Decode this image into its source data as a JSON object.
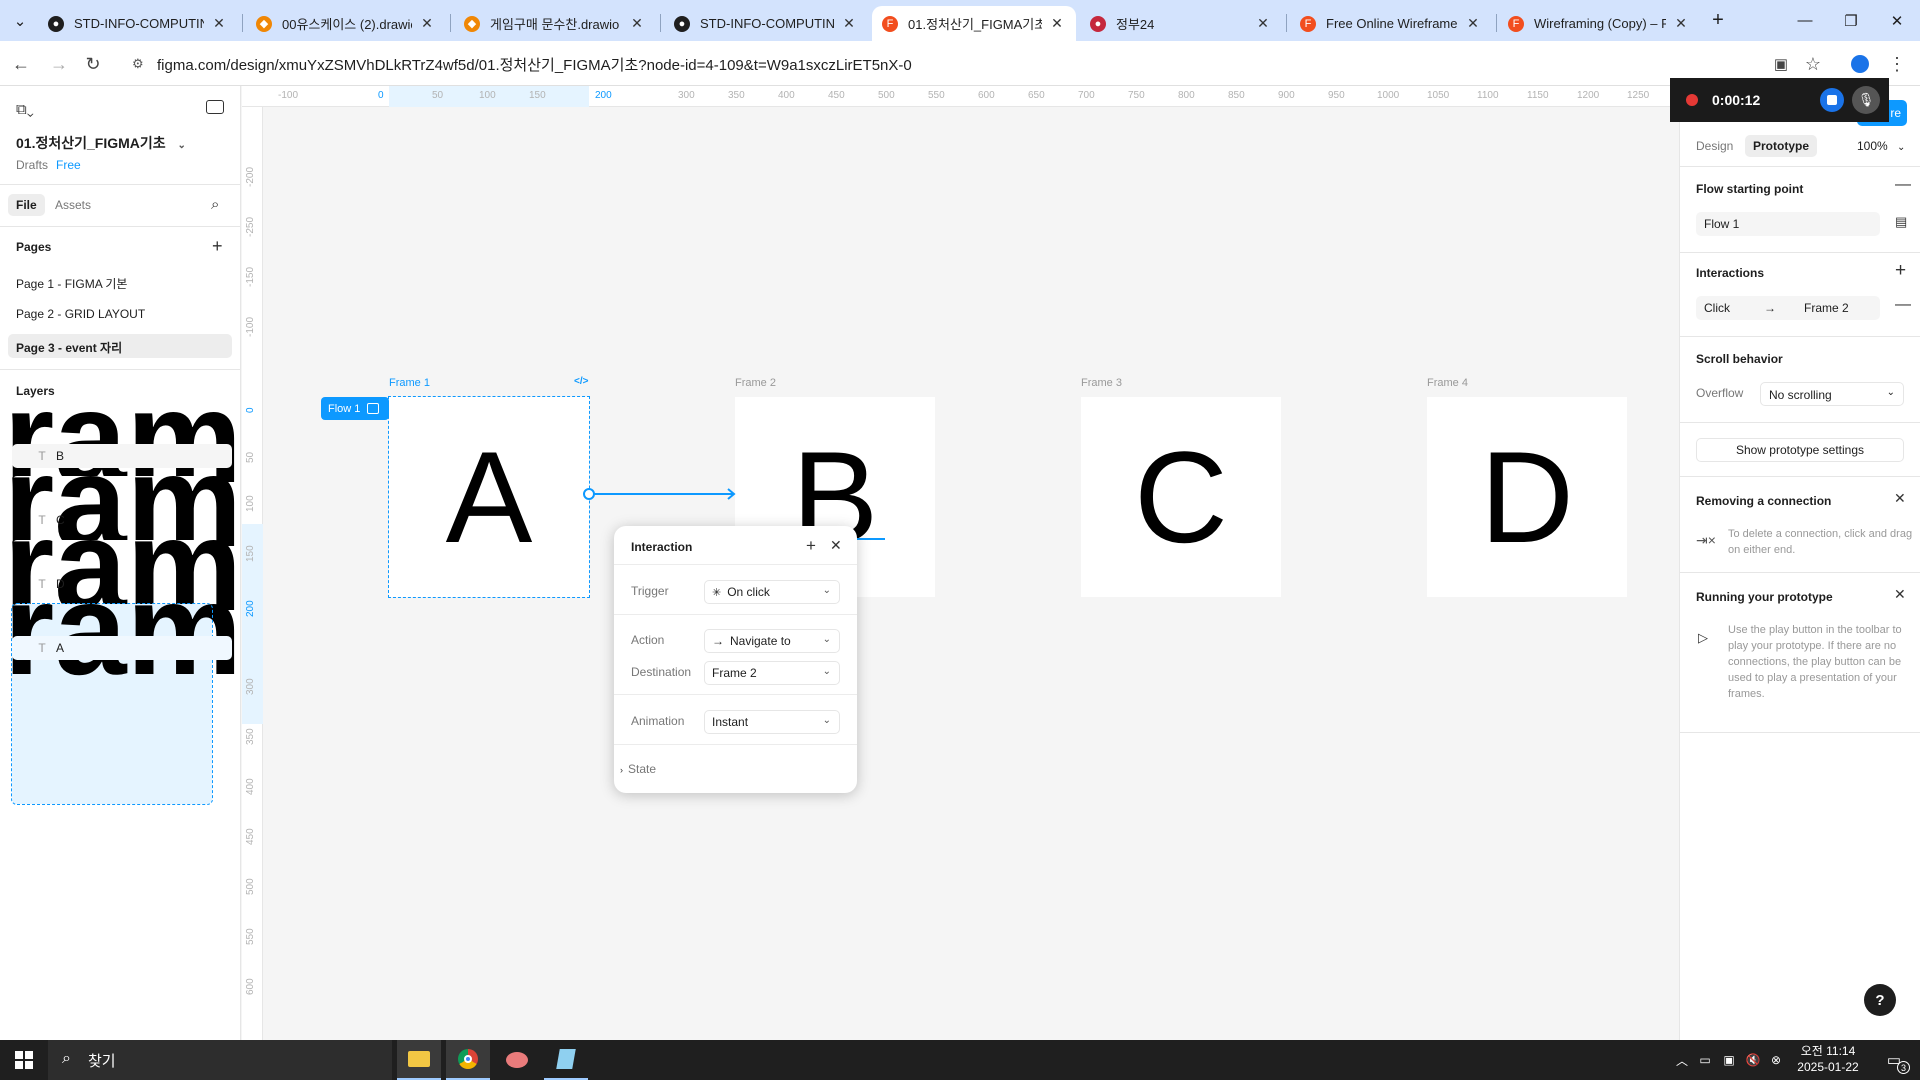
{
  "browser": {
    "tabs": [
      {
        "label": "STD-INFO-COMPUTING-",
        "icon": "github-icon",
        "color": "#1f1f1f"
      },
      {
        "label": "00유스케이스 (2).drawio",
        "icon": "drawio-icon",
        "color": "#f08705"
      },
      {
        "label": "게임구매 문수찬.drawio",
        "icon": "drawio-icon",
        "color": "#f08705"
      },
      {
        "label": "STD-INFO-COMPUTING-",
        "icon": "github-icon",
        "color": "#1f1f1f"
      },
      {
        "label": "01.정처산기_FIGMA기초",
        "icon": "figma-icon",
        "color": "#f24e1e",
        "active": true
      },
      {
        "label": "정부24",
        "icon": "gov24-icon",
        "color": "#c5283d"
      },
      {
        "label": "Free Online Wireframe K",
        "icon": "figma-icon",
        "color": "#f24e1e"
      },
      {
        "label": "Wireframing (Copy) – Fi",
        "icon": "figma-icon",
        "color": "#f24e1e"
      }
    ],
    "url": "figma.com/design/xmuYxZSMVhDLkRTrZ4wf5d/01.정처산기_FIGMA기초?node-id=4-109&t=W9a1sxczLirET5nX-0"
  },
  "figma": {
    "file_title": "01.정처산기_FIGMA기초",
    "drafts": "Drafts",
    "plan_badge": "Free",
    "file_tabs": {
      "file": "File",
      "assets": "Assets"
    },
    "pages_title": "Pages",
    "pages": [
      {
        "label": "Page 1 - FIGMA 기본"
      },
      {
        "label": "Page 2 - GRID LAYOUT"
      },
      {
        "label": "Page 3 - event 자리",
        "selected": true
      }
    ],
    "layers_title": "Layers",
    "layers": [
      {
        "label": "Frame 2",
        "type": "frame"
      },
      {
        "label": "B",
        "type": "text"
      },
      {
        "label": "Frame 3",
        "type": "frame"
      },
      {
        "label": "C",
        "type": "text"
      },
      {
        "label": "Frame 4",
        "type": "frame"
      },
      {
        "label": "D",
        "type": "text"
      },
      {
        "label": "Frame 1",
        "type": "frame",
        "selected": true
      },
      {
        "label": "A",
        "type": "text"
      }
    ]
  },
  "canvas": {
    "ruler_x": [
      "-100",
      "0",
      "50",
      "100",
      "150",
      "200",
      "300",
      "350",
      "400",
      "450",
      "500",
      "550",
      "600",
      "650",
      "700",
      "750",
      "800",
      "850",
      "900",
      "950",
      "1000",
      "1050",
      "1100",
      "1150",
      "1200",
      "1250"
    ],
    "ruler_y": [
      "-250",
      "-200",
      "-150",
      "-100",
      "0",
      "50",
      "100",
      "150",
      "200",
      "300",
      "350",
      "400",
      "450",
      "500",
      "550",
      "600"
    ],
    "frames": [
      {
        "label": "Frame 1",
        "content": "A",
        "selected": true
      },
      {
        "label": "Frame 2",
        "content": "B"
      },
      {
        "label": "Frame 3",
        "content": "C"
      },
      {
        "label": "Frame 4",
        "content": "D"
      }
    ],
    "flow_badge": "Flow 1"
  },
  "interaction_popup": {
    "title": "Interaction",
    "trigger_label": "Trigger",
    "trigger_value": "On click",
    "action_label": "Action",
    "action_value": "Navigate to",
    "destination_label": "Destination",
    "destination_value": "Frame 2",
    "animation_label": "Animation",
    "animation_value": "Instant",
    "state_label": "State"
  },
  "right_panel": {
    "tab_design": "Design",
    "tab_prototype": "Prototype",
    "zoom": "100%",
    "flow_start_title": "Flow starting point",
    "flow_name": "Flow 1",
    "interactions_title": "Interactions",
    "interaction_trigger": "Click",
    "interaction_target": "Frame 2",
    "scroll_title": "Scroll behavior",
    "overflow_label": "Overflow",
    "overflow_value": "No scrolling",
    "show_settings": "Show prototype settings",
    "removing_title": "Removing a connection",
    "removing_text": "To delete a connection, click and drag on either end.",
    "running_title": "Running your prototype",
    "running_text": "Use the play button in the toolbar to play your prototype. If there are no connections, the play button can be used to play a presentation of your frames."
  },
  "recorder": {
    "time": "0:00:12"
  },
  "share_label": "re",
  "help_label": "?",
  "taskbar": {
    "search_placeholder": "찾기",
    "time": "오전 11:14",
    "date": "2025-01-22",
    "notifications": "3"
  }
}
